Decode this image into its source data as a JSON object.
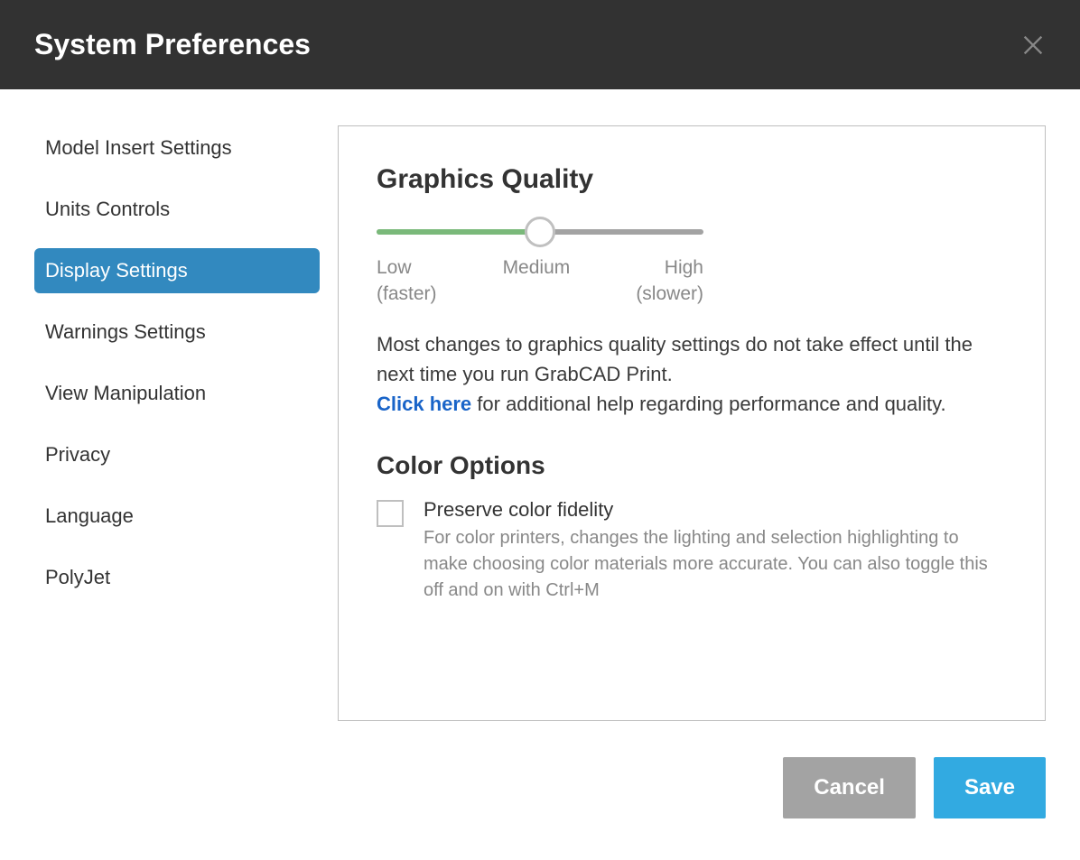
{
  "header": {
    "title": "System Preferences"
  },
  "sidebar": {
    "items": [
      {
        "label": "Model Insert Settings",
        "active": false
      },
      {
        "label": "Units Controls",
        "active": false
      },
      {
        "label": "Display Settings",
        "active": true
      },
      {
        "label": "Warnings Settings",
        "active": false
      },
      {
        "label": "View Manipulation",
        "active": false
      },
      {
        "label": "Privacy",
        "active": false
      },
      {
        "label": "Language",
        "active": false
      },
      {
        "label": "PolyJet",
        "active": false
      }
    ]
  },
  "main": {
    "graphics_quality": {
      "heading": "Graphics Quality",
      "slider": {
        "value_percent": 50,
        "labels": {
          "low": "Low",
          "low_hint": "(faster)",
          "medium": "Medium",
          "high": "High",
          "high_hint": "(slower)"
        }
      },
      "description_prefix": "Most changes to graphics quality settings do not take effect until the next time you run GrabCAD Print.",
      "link_text": "Click here",
      "description_suffix": " for additional help regarding performance and quality."
    },
    "color_options": {
      "heading": "Color Options",
      "checkbox": {
        "checked": false,
        "label": "Preserve color fidelity",
        "hint": "For color printers, changes the lighting and selection highlighting to make choosing color materials more accurate. You can also toggle this off and on with Ctrl+M"
      }
    }
  },
  "footer": {
    "cancel": "Cancel",
    "save": "Save"
  }
}
